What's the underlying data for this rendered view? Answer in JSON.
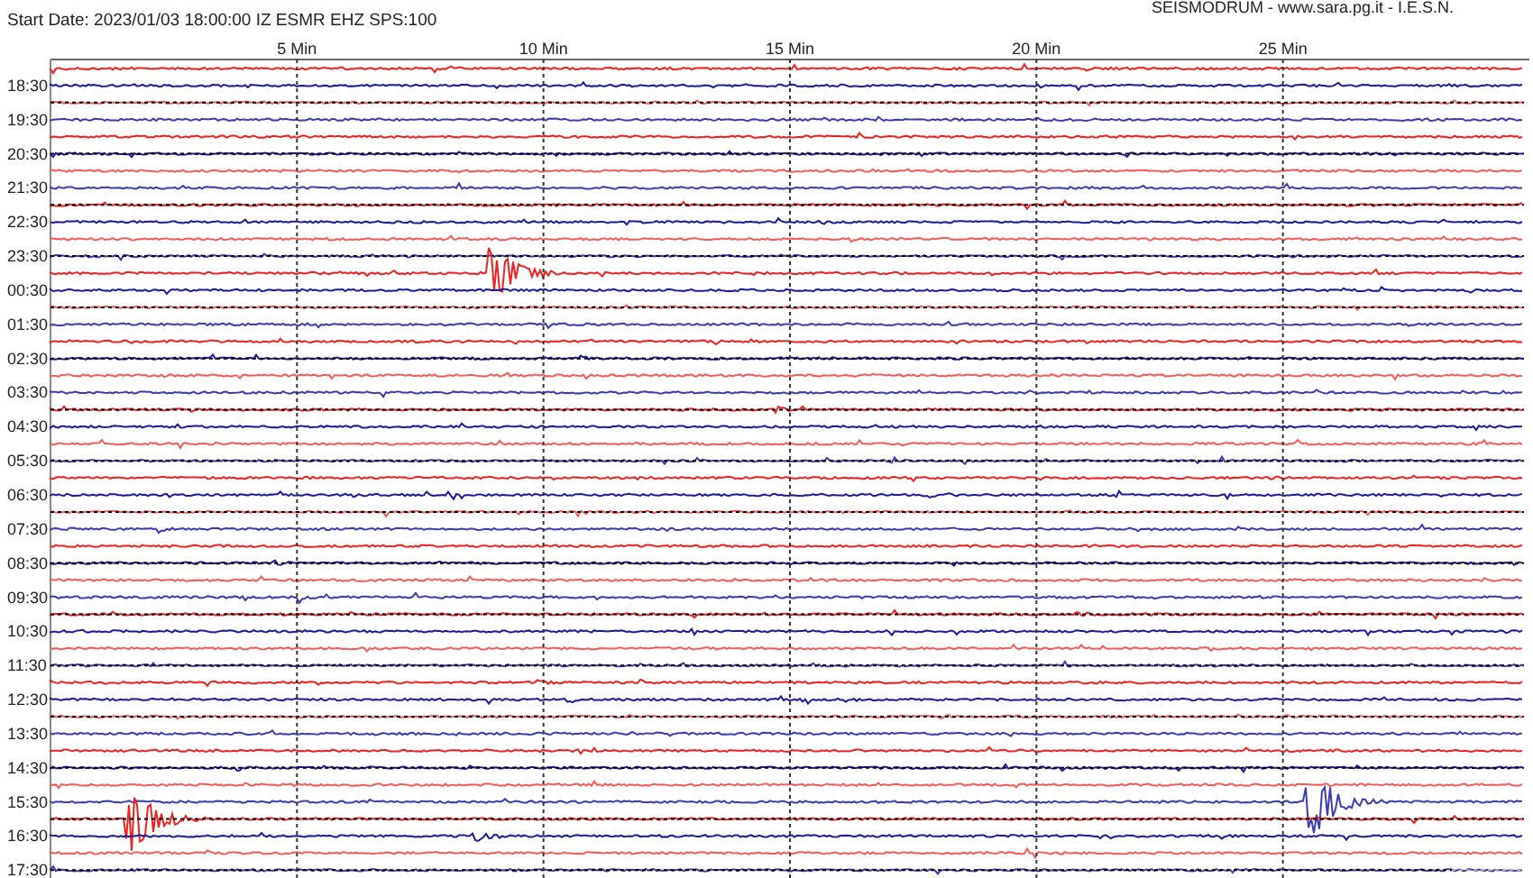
{
  "header": {
    "start_date": "Start Date: 2023/01/03 18:00:00 IZ ESMR EHZ SPS:100",
    "credit": "SEISMODRUM - www.sara.pg.it - I.E.S.N."
  },
  "x_axis_labels": [
    "5 Min",
    "10 Min",
    "15 Min",
    "20 Min",
    "25 Min"
  ],
  "row_labels": [
    "18:30",
    "19:30",
    "20:30",
    "21:30",
    "22:30",
    "23:30",
    "00:30",
    "01:30",
    "02:30",
    "03:30",
    "04:30",
    "05:30",
    "06:30",
    "07:30",
    "08:30",
    "09:30",
    "10:30",
    "11:30",
    "12:30",
    "13:30",
    "14:30",
    "15:30",
    "16:30",
    "17:30"
  ]
}
